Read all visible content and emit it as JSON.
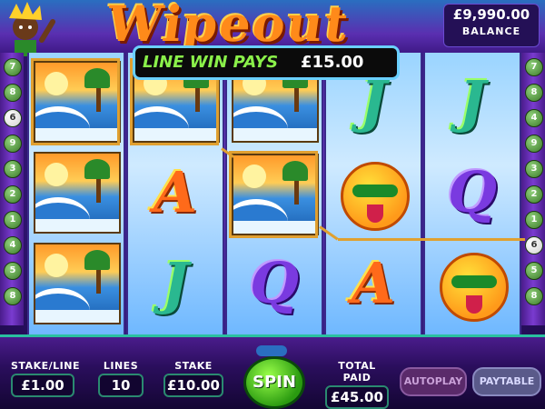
{
  "game": {
    "logo": "Wipeout"
  },
  "balance": {
    "value": "£9,990.00",
    "label": "BALANCE"
  },
  "win_banner": {
    "label": "LINE WIN PAYS",
    "amount": "£15.00"
  },
  "left_line_markers": [
    "7",
    "8",
    "6",
    "9",
    "3",
    "2",
    "1",
    "4",
    "5",
    "8"
  ],
  "right_line_markers": [
    "7",
    "8",
    "4",
    "9",
    "3",
    "2",
    "1",
    "6",
    "5",
    "8"
  ],
  "reels": [
    [
      "wave",
      "wave",
      "wave"
    ],
    [
      "wave",
      "A",
      "J"
    ],
    [
      "wave",
      "wave",
      "Q"
    ],
    [
      "J",
      "sun",
      "A"
    ],
    [
      "J",
      "Q",
      "sun"
    ]
  ],
  "controls": {
    "stake_line_label": "STAKE/LINE",
    "stake_line_value": "£1.00",
    "lines_label": "LINES",
    "lines_value": "10",
    "stake_label": "STAKE",
    "stake_value": "£10.00",
    "spin_label": "SPIN",
    "total_paid_label": "TOTAL PAID",
    "total_paid_value": "£45.00",
    "autoplay_label": "AUTOPLAY",
    "paytable_label": "PAYTABLE"
  },
  "colors": {
    "win_frame": "#e0a030",
    "banner_text": "#8af04a",
    "panel_trim": "#2ac0a0"
  }
}
